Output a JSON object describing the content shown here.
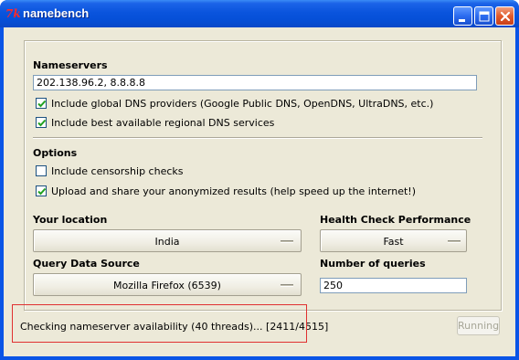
{
  "window": {
    "title": "namebench",
    "icon": "tk-feather-icon"
  },
  "nameservers": {
    "heading": "Nameservers",
    "value": "202.138.96.2, 8.8.8.8",
    "include_global": {
      "label": "Include global DNS providers (Google Public DNS, OpenDNS, UltraDNS, etc.)",
      "checked": true
    },
    "include_regional": {
      "label": "Include best available regional DNS services",
      "checked": true
    }
  },
  "options": {
    "heading": "Options",
    "censorship": {
      "label": "Include censorship checks",
      "checked": false
    },
    "upload": {
      "label": "Upload and share your anonymized results (help speed up the internet!)",
      "checked": true
    }
  },
  "location": {
    "heading": "Your location",
    "value": "India"
  },
  "health_check": {
    "heading": "Health Check Performance",
    "value": "Fast"
  },
  "query_source": {
    "heading": "Query Data Source",
    "value": "Mozilla Firefox (6539)"
  },
  "queries": {
    "heading": "Number of queries",
    "value": "250"
  },
  "status": {
    "text": "Checking nameserver availability (40 threads)... [2411/4515]"
  },
  "action_button": {
    "label": "Running",
    "enabled": false
  }
}
